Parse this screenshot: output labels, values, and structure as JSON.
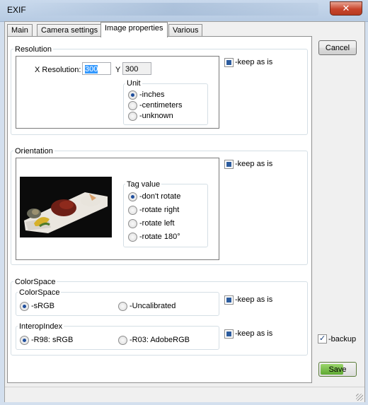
{
  "window": {
    "title": "EXIF",
    "close_glyph": "✕"
  },
  "tabs": [
    {
      "label": "Main",
      "active": false
    },
    {
      "label": "Camera settings",
      "active": false
    },
    {
      "label": "Image properties",
      "active": true
    },
    {
      "label": "Various",
      "active": false
    }
  ],
  "resolution": {
    "group_label": "Resolution",
    "x_label": "X Resolution:",
    "x_value": "300",
    "y_label": "Y",
    "y_value": "300",
    "unit_label": "Unit",
    "unit_options": [
      {
        "label": "-inches",
        "checked": true
      },
      {
        "label": "-centimeters",
        "checked": false
      },
      {
        "label": "-unknown",
        "checked": false
      }
    ],
    "keep_label": "-keep as is",
    "keep_checked": true
  },
  "orientation": {
    "group_label": "Orientation",
    "tag_label": "Tag value",
    "options": [
      {
        "label": "-don't rotate",
        "checked": true
      },
      {
        "label": "-rotate right",
        "checked": false
      },
      {
        "label": "-rotate left",
        "checked": false
      },
      {
        "label": "-rotate 180°",
        "checked": false
      }
    ],
    "keep_label": "-keep as is",
    "keep_checked": true
  },
  "colorspace": {
    "group_label": "ColorSpace",
    "inner_label": "ColorSpace",
    "options": [
      {
        "label": "-sRGB",
        "checked": true
      },
      {
        "label": "-Uncalibrated",
        "checked": false
      }
    ],
    "keep_label": "-keep as is",
    "keep_checked": true
  },
  "interop": {
    "group_label": "InteropIndex",
    "options": [
      {
        "label": "-R98: sRGB",
        "checked": true
      },
      {
        "label": "-R03: AdobeRGB",
        "checked": false
      }
    ],
    "keep_label": "-keep as is",
    "keep_checked": true
  },
  "actions": {
    "cancel_label": "Cancel",
    "backup_label": "-backup",
    "backup_checked": true,
    "save_label": "Save"
  },
  "colors": {
    "selection": "#3399ff",
    "checkbox_fill": "#2d5c9e",
    "save_button": "#7cc24a"
  }
}
